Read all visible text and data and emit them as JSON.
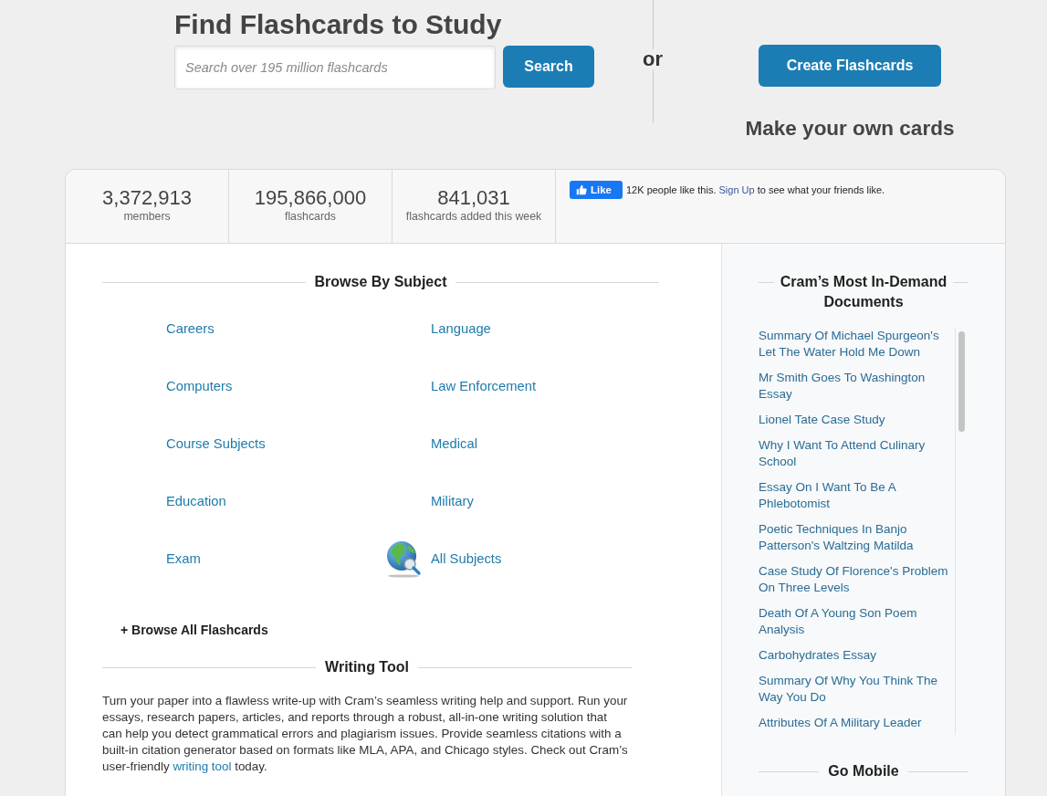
{
  "header": {
    "title": "Find Flashcards to Study",
    "search": {
      "placeholder": "Search over 195 million flashcards",
      "button": "Search"
    },
    "divider_text": "or",
    "create": {
      "button": "Create Flashcards",
      "caption": "Make your own cards"
    }
  },
  "stats": [
    {
      "value": "3,372,913",
      "label": "members"
    },
    {
      "value": "195,866,000",
      "label": "flashcards"
    },
    {
      "value": "841,031",
      "label": "flashcards added this week"
    }
  ],
  "facebook": {
    "button": "Like",
    "text_before": "12K people like this.",
    "link": "Sign Up",
    "text_after": "to see what your friends like."
  },
  "browse": {
    "heading": "Browse By Subject",
    "subjects": [
      {
        "label": "Careers",
        "kind": "subject"
      },
      {
        "label": "Language",
        "kind": "subject"
      },
      {
        "label": "Computers",
        "kind": "subject"
      },
      {
        "label": "Law Enforcement",
        "kind": "subject"
      },
      {
        "label": "Course Subjects",
        "kind": "subject"
      },
      {
        "label": "Medical",
        "kind": "subject"
      },
      {
        "label": "Education",
        "kind": "subject"
      },
      {
        "label": "Military",
        "kind": "subject"
      },
      {
        "label": "Exam",
        "kind": "subject"
      },
      {
        "label": "All Subjects",
        "kind": "all"
      }
    ],
    "browse_all": "+ Browse All Flashcards"
  },
  "writing_tool": {
    "heading": "Writing Tool",
    "text_before": "Turn your paper into a flawless write-up with Cram’s seamless writing help and support. Run your essays, research papers, articles, and reports through a robust, all-in-one writing solution that can help you detect grammatical errors and plagiarism issues. Provide seamless citations with a built-in citation generator based on formats like MLA, APA, and Chicago styles. Check out Cram’s user-friendly",
    "link": "writing tool",
    "text_after": "today."
  },
  "documents": {
    "heading": "Cram’s Most In-Demand Documents",
    "items": [
      "Summary Of Michael Spurgeon's Let The Water Hold Me Down",
      "Mr Smith Goes To Washington Essay",
      "Lionel Tate Case Study",
      "Why I Want To Attend Culinary School",
      "Essay On I Want To Be A Phlebotomist",
      "Poetic Techniques In Banjo Patterson's Waltzing Matilda",
      "Case Study Of Florence's Problem On Three Levels",
      "Death Of A Young Son Poem Analysis",
      "Carbohydrates Essay",
      "Summary Of Why You Think The Way You Do",
      "Attributes Of A Military Leader"
    ]
  },
  "go_mobile": {
    "heading": "Go Mobile"
  }
}
